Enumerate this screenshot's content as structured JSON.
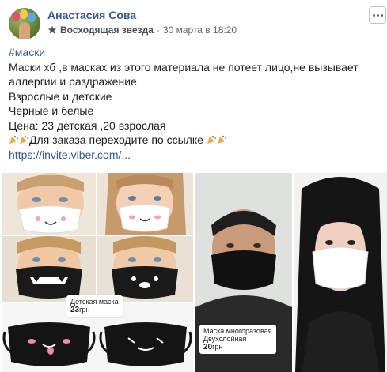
{
  "post": {
    "author": "Анастасия Сова",
    "badge": "Восходящая звезда",
    "dot": "·",
    "timestamp": "30 марта в 18:20",
    "hashtag": "#маски",
    "lines": [
      "Маски хб ,в масках из этого материала не потеет лицо,не вызывает",
      "аллергии и раздражение",
      "Взрослые и детские",
      "Черные и белые",
      "Цена: 23 детская ,20 взрослая"
    ],
    "order_text": "Для заказа переходите по ссылке",
    "link": "https://invite.viber.com/..."
  },
  "photos": {
    "kids_tag_title": "Детская маска",
    "kids_tag_price": "23",
    "kids_tag_currency": "грн",
    "adult_tag_title": "Маска многоразовая",
    "adult_tag_subtitle": "Двухслойная",
    "adult_tag_price": "20",
    "adult_tag_currency": "грн"
  },
  "icons": {
    "avatar": "avatar",
    "badge": "star-icon",
    "more": "more-options-icon",
    "emoji": "party-popper-icon"
  },
  "colors": {
    "link": "#385898",
    "meta": "#616770"
  }
}
